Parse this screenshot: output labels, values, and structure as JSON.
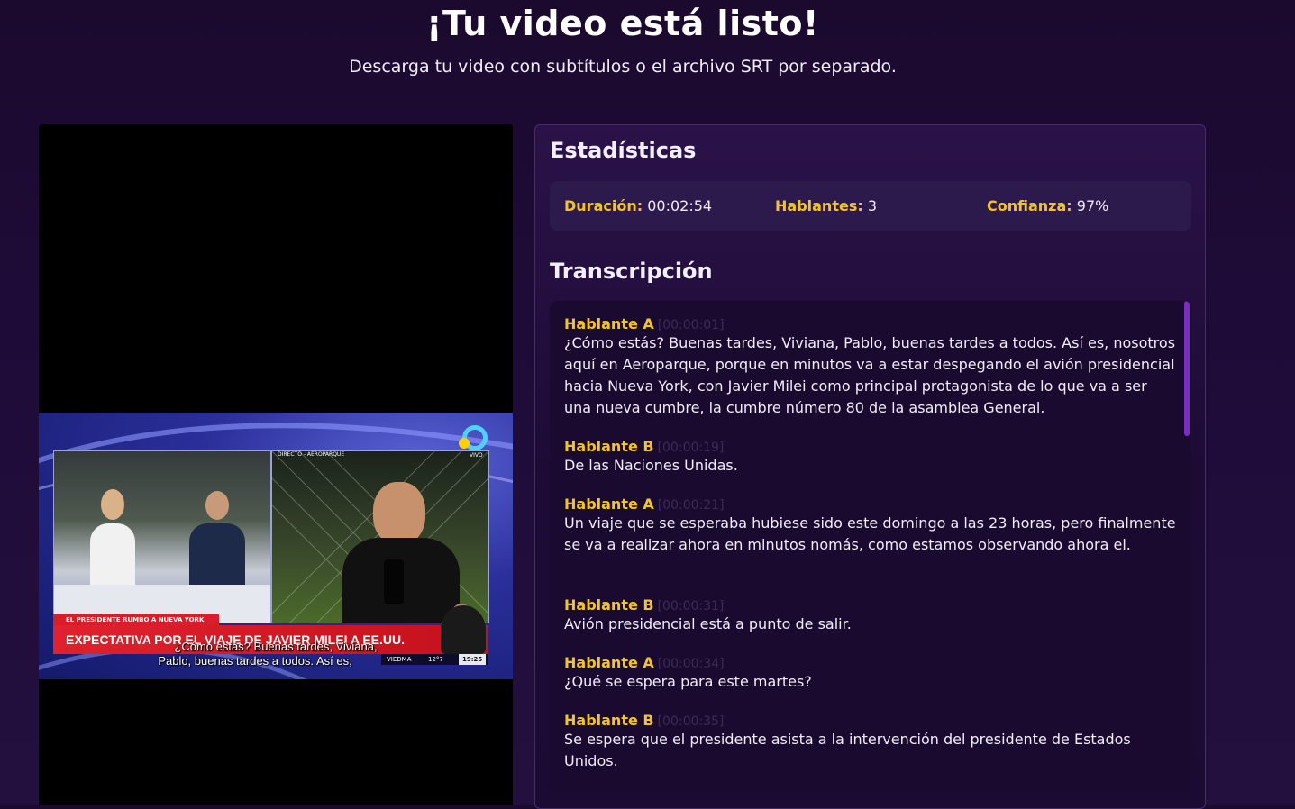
{
  "header": {
    "title": "¡Tu video está listo!",
    "subtitle": "Descarga tu video con subtítulos o el archivo SRT por separado."
  },
  "video": {
    "studio_label": "DIRECTO - AEROPARQUE",
    "vivo_label": "VIVO",
    "lower_third_small": "EL PRESIDENTE RUMBO A NUEVA YORK",
    "lower_third_big": "EXPECTATIVA POR EL VIAJE DE JAVIER MILEI A EE.UU.",
    "ticker_city": "VIEDMA",
    "ticker_temp": "12°7",
    "ticker_clock": "19:25",
    "caption_line1": "¿Cómo estás? Buenas tardes, Viviana,",
    "caption_line2": "Pablo, buenas tardes a todos. Así es,"
  },
  "stats": {
    "title": "Estadísticas",
    "duration_label": "Duración:",
    "duration_value": "00:02:54",
    "speakers_label": "Hablantes:",
    "speakers_value": "3",
    "confidence_label": "Confianza:",
    "confidence_value": "97%"
  },
  "transcript": {
    "title": "Transcripción",
    "entries": [
      {
        "speaker": "Hablante A",
        "time": "[00:00:01]",
        "text": "¿Cómo estás? Buenas tardes, Viviana, Pablo, buenas tardes a todos. Así es, nosotros aquí en Aeroparque, porque en minutos va a estar despegando el avión presidencial hacia Nueva York, con Javier Milei como principal protagonista de lo que va a ser una nueva cumbre, la cumbre número 80 de la asamblea General."
      },
      {
        "speaker": "Hablante B",
        "time": "[00:00:19]",
        "text": "De las Naciones Unidas."
      },
      {
        "speaker": "Hablante A",
        "time": "[00:00:21]",
        "text": "Un viaje que se esperaba hubiese sido este domingo a las 23 horas, pero finalmente se va a realizar ahora en minutos nomás, como estamos observando ahora el."
      },
      {
        "speaker": "Hablante B",
        "time": "[00:00:31]",
        "text": "Avión presidencial está a punto de salir."
      },
      {
        "speaker": "Hablante A",
        "time": "[00:00:34]",
        "text": "¿Qué se espera para este martes?"
      },
      {
        "speaker": "Hablante B",
        "time": "[00:00:35]",
        "text": "Se espera que el presidente asista a la intervención del presidente de Estados Unidos."
      }
    ]
  }
}
